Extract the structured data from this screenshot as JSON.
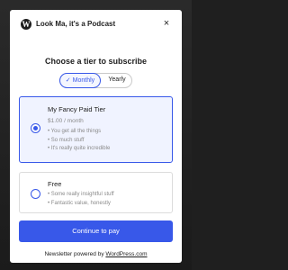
{
  "site": {
    "logo_glyph": "W",
    "name": "Look Ma, it's a Podcast"
  },
  "close_glyph": "×",
  "heading": "Choose a tier to subscribe",
  "billing_toggle": {
    "check_glyph": "✓",
    "monthly": "Monthly",
    "yearly": "Yearly",
    "selected": "Monthly"
  },
  "tiers": [
    {
      "name": "My Fancy Paid Tier",
      "price": "$1.00 / month",
      "selected": true,
      "features": [
        "You get all the things",
        "So much stuff",
        "It's really quite incredible"
      ]
    },
    {
      "name": "Free",
      "selected": false,
      "features": [
        "Some really insightful stuff",
        "Fantastic value, honestly"
      ]
    }
  ],
  "cta_label": "Continue to pay",
  "footer": {
    "prefix": "Newsletter powered by ",
    "link": "WordPress.com"
  },
  "colors": {
    "accent": "#3858e9",
    "selected_tier_bg": "#f0f3ff",
    "muted_text": "#8a8a8a"
  }
}
